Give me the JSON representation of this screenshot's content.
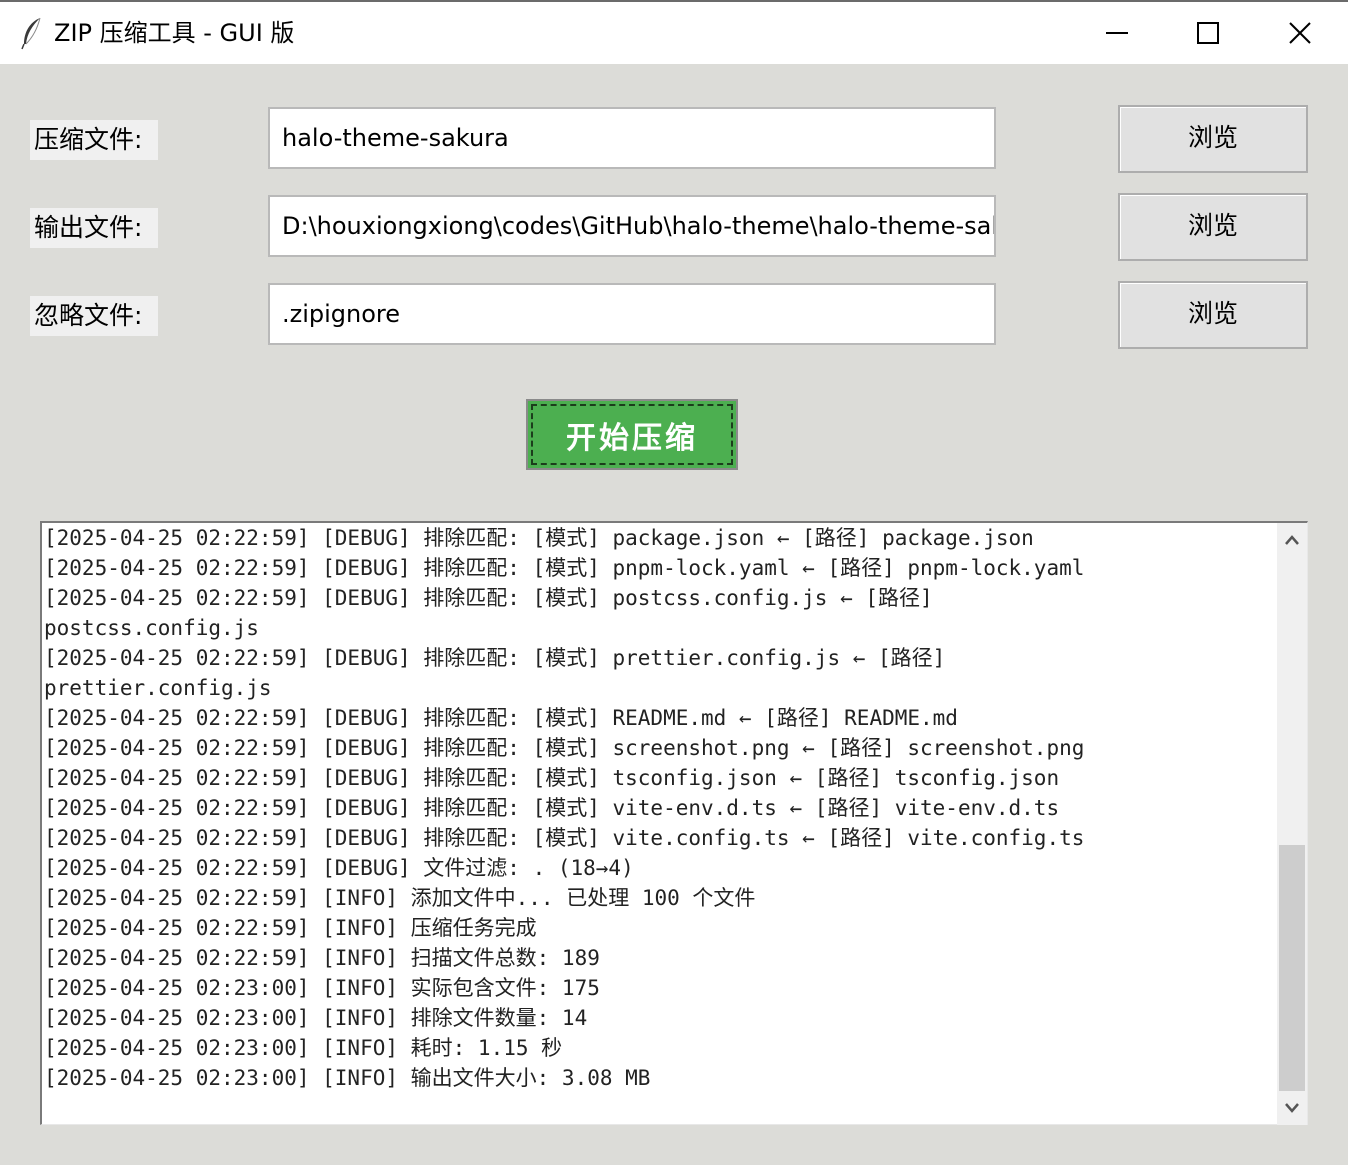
{
  "window": {
    "title": "ZIP 压缩工具 - GUI 版",
    "icon": "feather-icon"
  },
  "form": {
    "rows": [
      {
        "label": "压缩文件:",
        "value": "halo-theme-sakura",
        "button": "浏览"
      },
      {
        "label": "输出文件:",
        "value": "D:\\houxiongxiong\\codes\\GitHub\\halo-theme\\halo-theme-sal",
        "button": "浏览"
      },
      {
        "label": "忽略文件:",
        "value": ".zipignore",
        "button": "浏览"
      }
    ],
    "start_button": "开始压缩"
  },
  "log": {
    "lines": [
      "[2025-04-25 02:22:59] [DEBUG] 排除匹配: [模式] package.json ← [路径] package.json",
      "[2025-04-25 02:22:59] [DEBUG] 排除匹配: [模式] pnpm-lock.yaml ← [路径] pnpm-lock.yaml",
      "[2025-04-25 02:22:59] [DEBUG] 排除匹配: [模式] postcss.config.js ← [路径]",
      "postcss.config.js",
      "[2025-04-25 02:22:59] [DEBUG] 排除匹配: [模式] prettier.config.js ← [路径]",
      "prettier.config.js",
      "[2025-04-25 02:22:59] [DEBUG] 排除匹配: [模式] README.md ← [路径] README.md",
      "[2025-04-25 02:22:59] [DEBUG] 排除匹配: [模式] screenshot.png ← [路径] screenshot.png",
      "[2025-04-25 02:22:59] [DEBUG] 排除匹配: [模式] tsconfig.json ← [路径] tsconfig.json",
      "[2025-04-25 02:22:59] [DEBUG] 排除匹配: [模式] vite-env.d.ts ← [路径] vite-env.d.ts",
      "[2025-04-25 02:22:59] [DEBUG] 排除匹配: [模式] vite.config.ts ← [路径] vite.config.ts",
      "[2025-04-25 02:22:59] [DEBUG] 文件过滤: . (18→4)",
      "[2025-04-25 02:22:59] [INFO] 添加文件中... 已处理 100 个文件",
      "[2025-04-25 02:22:59] [INFO] 压缩任务完成",
      "[2025-04-25 02:22:59] [INFO] 扫描文件总数: 189",
      "[2025-04-25 02:23:00] [INFO] 实际包含文件: 175",
      "[2025-04-25 02:23:00] [INFO] 排除文件数量: 14",
      "[2025-04-25 02:23:00] [INFO] 耗时: 1.15 秒",
      "[2025-04-25 02:23:00] [INFO] 输出文件大小: 3.08 MB"
    ],
    "scroll_position": 0.85
  },
  "colors": {
    "start_button": "#4caf50",
    "window_bg": "#dcdcd8"
  }
}
